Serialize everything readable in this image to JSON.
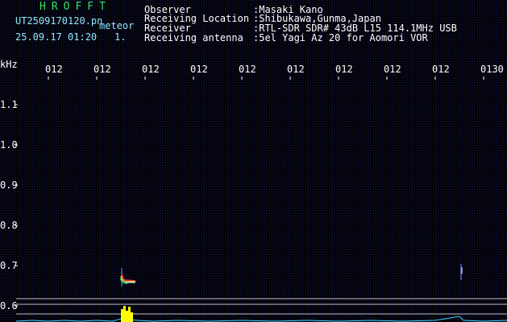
{
  "header": {
    "title": "HROFFT",
    "filename": "UT2509170120.pn",
    "datetime": "25.09.17 01:20",
    "counter": "1.",
    "mode": "meteor"
  },
  "info": {
    "labels": [
      "Observer",
      "Receiving Location",
      "Receiver",
      "Receiving antenna"
    ],
    "values": [
      ":Masaki Kano",
      ":Shibukawa,Gunma,Japan",
      ":RTL-SDR SDR# 43dB L15 114.1MHz USB",
      ":5el Yagi Az 20 for Aomori VOR"
    ]
  },
  "axis": {
    "unit": "kHz",
    "time_ticks": [
      "012",
      "012",
      "012",
      "012",
      "012",
      "012",
      "012",
      "012",
      "012",
      "0130"
    ],
    "freq_ticks": [
      "1.1",
      "1.0",
      "0.9",
      "0.8",
      "0.7",
      "0.6"
    ]
  },
  "colors": {
    "background": "#000000",
    "noise": "#2a2a8c",
    "title_green": "#33e05a",
    "trace_cyan": "#40d8ff",
    "echo_yellow": "#ffff00"
  }
}
